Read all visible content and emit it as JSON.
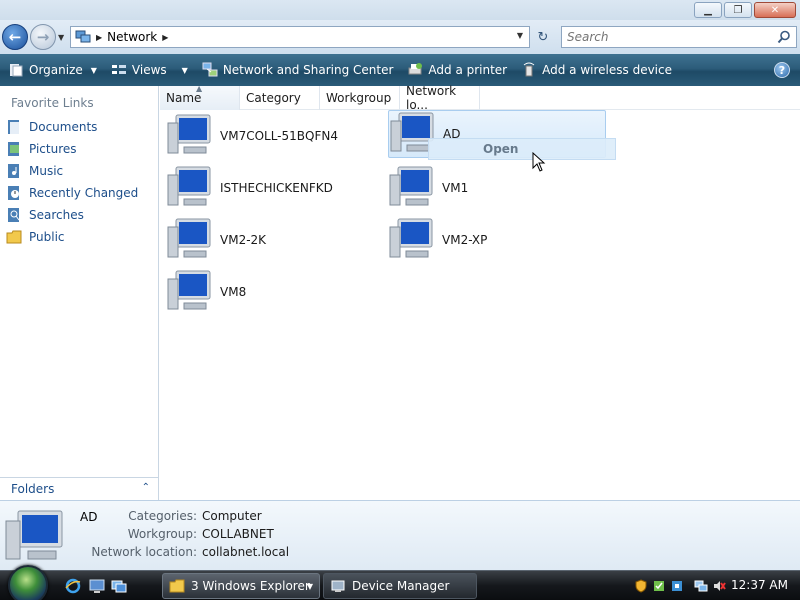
{
  "window": {
    "minimize_glyph": "▁",
    "maximize_glyph": "❐",
    "close_glyph": "✕"
  },
  "address_bar": {
    "back_glyph": "←",
    "forward_glyph": "→",
    "location_icon": "network-icon",
    "breadcrumb": "Network",
    "refresh_glyph": "↻"
  },
  "search": {
    "placeholder": "Search",
    "value": ""
  },
  "toolbar": {
    "organize": "Organize",
    "views": "Views",
    "network_sharing": "Network and Sharing Center",
    "add_printer": "Add a printer",
    "add_wireless": "Add a wireless device",
    "help_glyph": "?"
  },
  "sidebar": {
    "header": "Favorite Links",
    "items": [
      {
        "label": "Documents",
        "icon": "documents-icon"
      },
      {
        "label": "Pictures",
        "icon": "pictures-icon"
      },
      {
        "label": "Music",
        "icon": "music-icon"
      },
      {
        "label": "Recently Changed",
        "icon": "recently-changed-icon"
      },
      {
        "label": "Searches",
        "icon": "searches-icon"
      },
      {
        "label": "Public",
        "icon": "public-folder-icon"
      }
    ],
    "folders_label": "Folders",
    "folders_chevron": "⌃"
  },
  "columns": [
    "Name",
    "Category",
    "Workgroup",
    "Network lo..."
  ],
  "computers": [
    {
      "name": "VM7COLL-51BQFN4"
    },
    {
      "name": "AD"
    },
    {
      "name": "ISTHECHICKENFKD"
    },
    {
      "name": "VM1"
    },
    {
      "name": "VM2-2K"
    },
    {
      "name": "VM2-XP"
    },
    {
      "name": "VM8"
    }
  ],
  "selected_computer": "AD",
  "tooltip": "Open",
  "details": {
    "name": "AD",
    "rows": [
      {
        "key": "Categories:",
        "value": "Computer"
      },
      {
        "key": "Workgroup:",
        "value": "COLLABNET"
      },
      {
        "key": "Network location:",
        "value": "collabnet.local"
      }
    ]
  },
  "taskbar": {
    "buttons": [
      {
        "label": "3 Windows Explorer",
        "icon": "folder-icon",
        "active": true
      },
      {
        "label": "Device Manager",
        "icon": "device-manager-icon",
        "active": false
      }
    ],
    "clock": "12:37 AM"
  },
  "colors": {
    "command_bar": "#2c5c7a",
    "link_blue": "#1d4e8a",
    "selection": "#d6e9fa"
  }
}
